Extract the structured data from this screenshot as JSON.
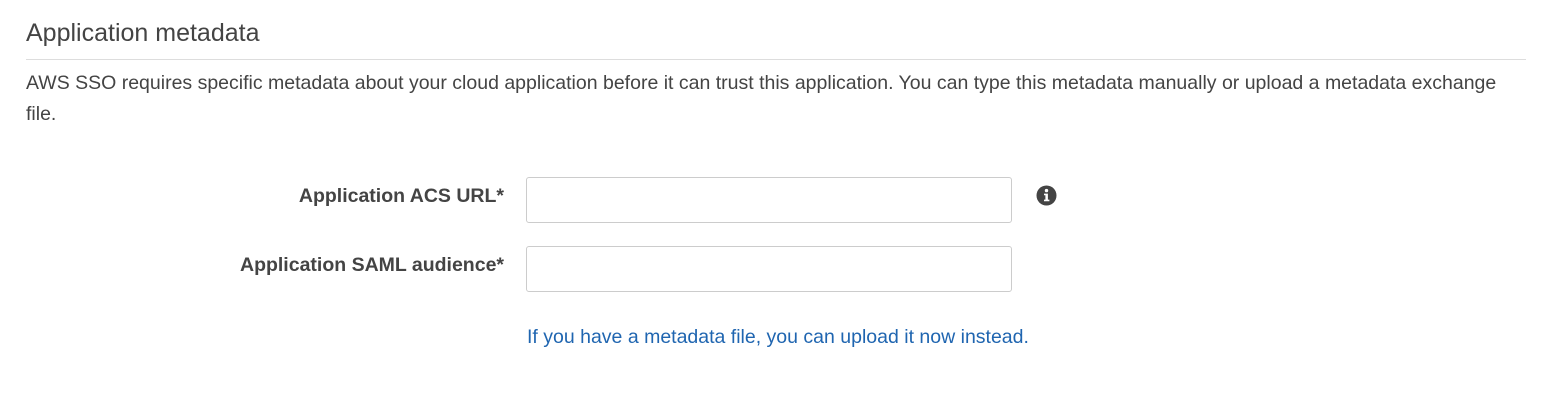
{
  "section": {
    "title": "Application metadata",
    "description": "AWS SSO requires specific metadata about your cloud application before it can trust this application. You can type this metadata manually or upload a metadata exchange file."
  },
  "form": {
    "acs_url": {
      "label": "Application ACS URL*",
      "value": "",
      "info_icon": "info-circle-icon"
    },
    "saml_audience": {
      "label": "Application SAML audience*",
      "value": ""
    },
    "upload_link": "If you have a metadata file, you can upload it now instead."
  },
  "colors": {
    "text": "#444444",
    "link": "#1f65b0",
    "border": "#cccccc",
    "divider": "#dddddd"
  }
}
